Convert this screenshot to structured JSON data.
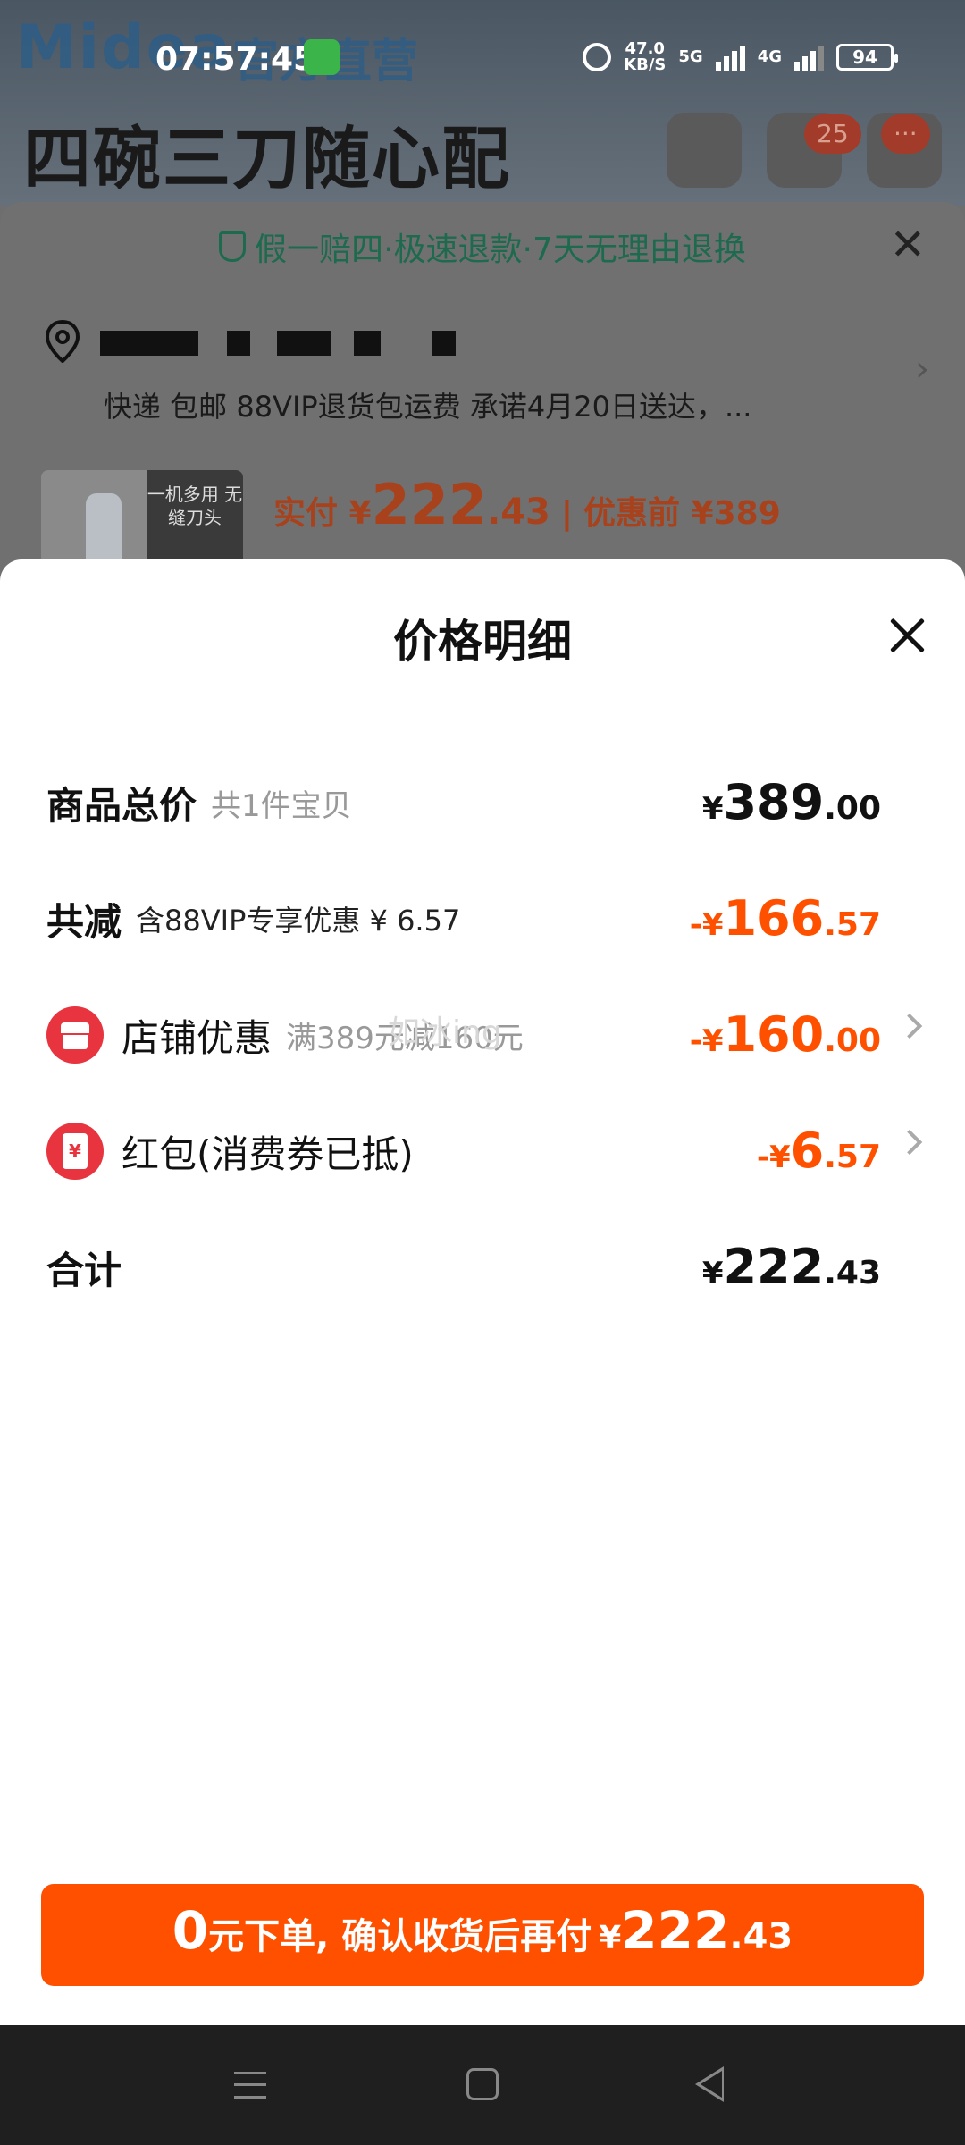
{
  "status_bar": {
    "time": "07:57:45",
    "net_speed": "47.0",
    "net_unit": "KB/S",
    "network_5g": "5G",
    "network_4g": "4G",
    "battery": "94"
  },
  "background": {
    "brand": "Midea",
    "brand_sub": "官方直营",
    "headline": "四碗三刀随心配",
    "cart_count": "25",
    "more_badge": "···",
    "guarantee": "假一赔四·极速退款·7天无理由退换",
    "address_line": "快递 包邮 88VIP退货包运费 承诺4月20日送达，...",
    "product_thumb_text": "一机多用 无缝刀头",
    "price_label": "实付 ¥",
    "price_int": "222",
    "price_dec": ".43",
    "price_sep": "|",
    "original_price": "优惠前 ¥389"
  },
  "modal": {
    "title": "价格明细",
    "rows": [
      {
        "label": "商品总价",
        "sub": "共1件宝贝",
        "currency": "¥",
        "int": "389",
        "dec": ".00"
      },
      {
        "label": "共减",
        "sub": "含88VIP专享优惠 ¥ 6.57",
        "currency": "-¥",
        "int": "166",
        "dec": ".57"
      },
      {
        "label": "店铺优惠",
        "sub": "满389元减160元",
        "currency": "-¥",
        "int": "160",
        "dec": ".00"
      },
      {
        "label": "红包(消费券已抵)",
        "sub": "",
        "currency": "-¥",
        "int": "6",
        "dec": ".57"
      },
      {
        "label": "合计",
        "sub": "",
        "currency": "¥",
        "int": "222",
        "dec": ".43"
      }
    ],
    "redpacket_mark": "¥",
    "watermark": "如冰ing"
  },
  "cta": {
    "zero": "0",
    "text": "元下单, 确认收货后再付",
    "currency": "¥",
    "int": "222",
    "dec": ".43"
  },
  "colors": {
    "accent": "#ff5000",
    "icon_red": "#e8343f",
    "guarantee_green": "#1e6a4f"
  }
}
